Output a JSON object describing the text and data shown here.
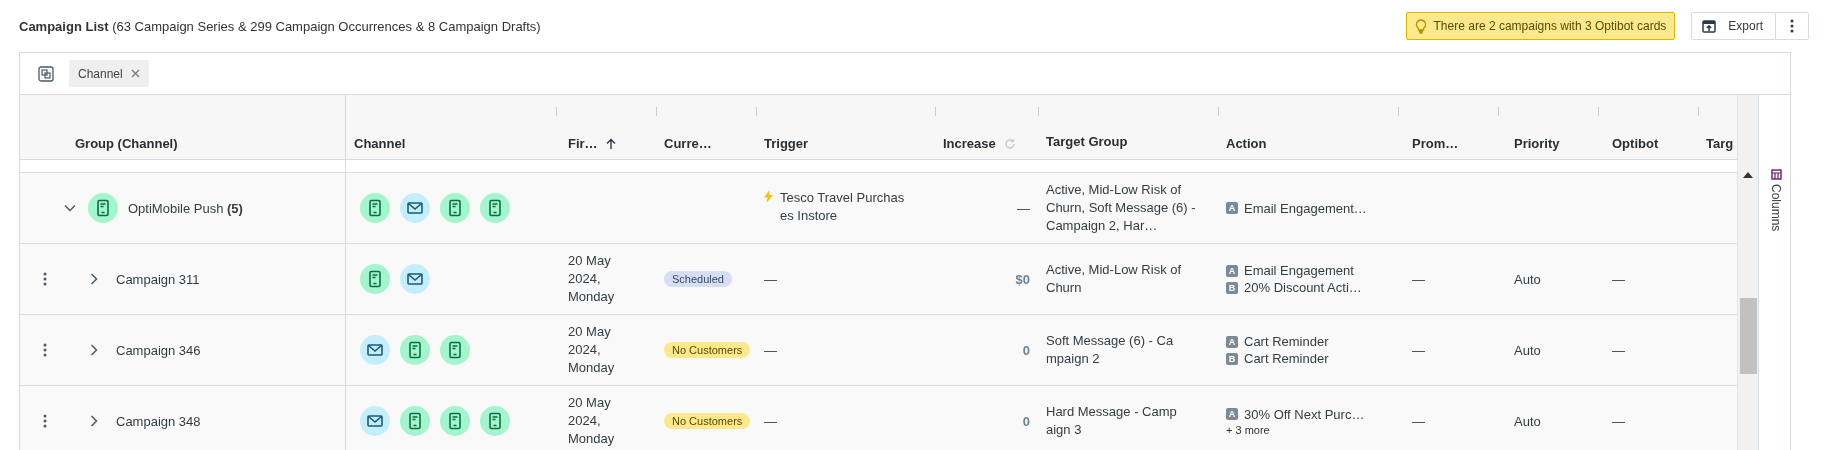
{
  "header": {
    "title": "Campaign List",
    "subtitle": "(63 Campaign Series & 299 Campaign Occurrences & 8 Campaign Drafts)",
    "notice": "There are 2 campaigns with 3 Optibot cards",
    "export": "Export"
  },
  "toolbar": {
    "group_chip": "Channel"
  },
  "columns": [
    {
      "label": "Group (Channel)"
    },
    {
      "label": "Channel"
    },
    {
      "label": "Fir…",
      "sorted": true
    },
    {
      "label": "Curre…"
    },
    {
      "label": "Trigger"
    },
    {
      "label": "Increase",
      "refreshable": true
    },
    {
      "label": "Target Group"
    },
    {
      "label": "Action"
    },
    {
      "label": "Prom…"
    },
    {
      "label": "Priority"
    },
    {
      "label": "Optibot"
    },
    {
      "label": "Targ"
    }
  ],
  "groups": [
    {
      "name": "OptiMobile Push",
      "count": "(5)",
      "channel": {
        "kind": "push"
      },
      "expanded": true,
      "channels": [
        {
          "kind": "push"
        },
        {
          "kind": "email"
        },
        {
          "kind": "push"
        },
        {
          "kind": "push"
        }
      ],
      "trigger": "Tesco Travel Purchases Instore",
      "increase": "—",
      "target": "Active, Mid-Low Risk of Churn, Soft Message (6) - Campaign 2, Har…",
      "actions": [
        {
          "variant": "A",
          "label": "Email Engagement…"
        }
      ],
      "children": [
        {
          "name": "Campaign 311",
          "expanded": false,
          "channels": [
            {
              "kind": "push"
            },
            {
              "kind": "email"
            }
          ],
          "first": "20 May 2024, Monday",
          "status": {
            "label": "Scheduled",
            "kind": "scheduled"
          },
          "trigger": "—",
          "increase": "$0",
          "target": "Active, Mid-Low Risk of Churn",
          "actions": [
            {
              "variant": "A",
              "label": "Email Engagement"
            },
            {
              "variant": "B",
              "label": "20% Discount Acti…"
            }
          ],
          "promo": "—",
          "priority": "Auto",
          "optibot": "—"
        },
        {
          "name": "Campaign 346",
          "expanded": false,
          "channels": [
            {
              "kind": "email"
            },
            {
              "kind": "push"
            },
            {
              "kind": "push"
            }
          ],
          "first": "20 May 2024, Monday",
          "status": {
            "label": "No Customers",
            "kind": "no_customers"
          },
          "trigger": "—",
          "increase": "0",
          "target": "Soft Message (6) - Campaign 2",
          "actions": [
            {
              "variant": "A",
              "label": "Cart Reminder"
            },
            {
              "variant": "B",
              "label": "Cart Reminder"
            }
          ],
          "promo": "—",
          "priority": "Auto",
          "optibot": "—"
        },
        {
          "name": "Campaign 348",
          "expanded": false,
          "channels": [
            {
              "kind": "email"
            },
            {
              "kind": "push"
            },
            {
              "kind": "push"
            },
            {
              "kind": "push"
            }
          ],
          "first": "20 May 2024, Monday",
          "status": {
            "label": "No Customers",
            "kind": "no_customers"
          },
          "trigger": "—",
          "increase": "0",
          "target": "Hard Message - Campaign 3",
          "actions": [
            {
              "variant": "A",
              "label": "30% Off Next Purc…"
            }
          ],
          "more": "+ 3 more",
          "promo": "—",
          "priority": "Auto",
          "optibot": "—"
        }
      ]
    }
  ],
  "side_panel": {
    "label": "Columns"
  }
}
